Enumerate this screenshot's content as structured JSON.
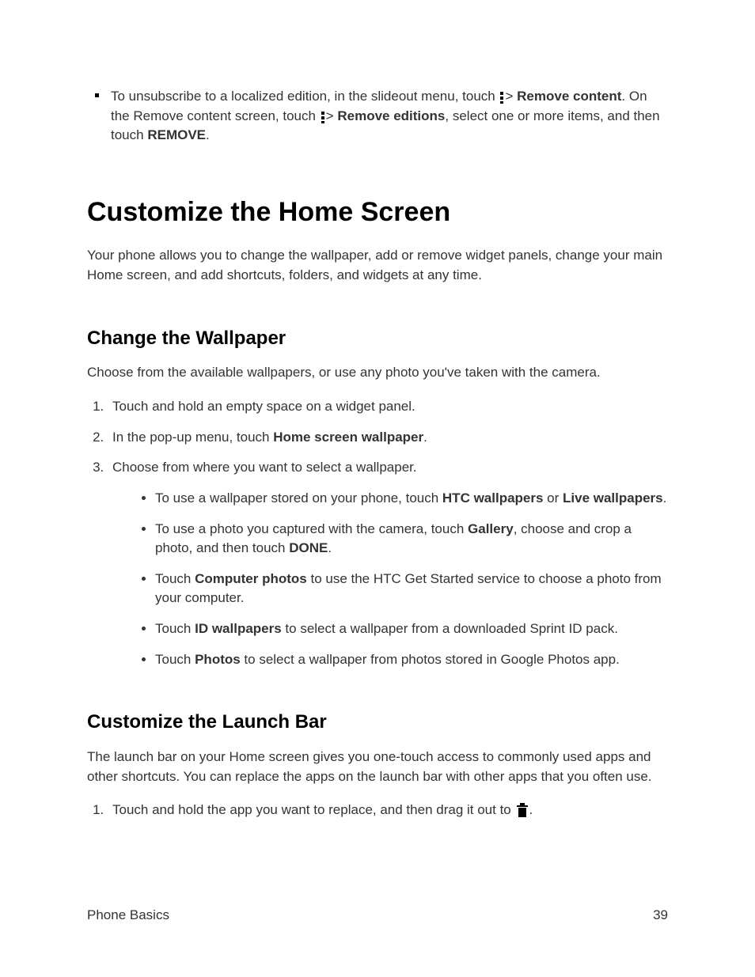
{
  "unsub": {
    "p1": "To unsubscribe to a localized edition, in the slideout menu, touch",
    "p2": ">",
    "b1": "Remove content",
    "p3": ". On the Remove content screen, touch",
    "p4": ">",
    "b2": "Remove editions",
    "p5": ", select one or more items, and then touch",
    "b3": "REMOVE",
    "p6": "."
  },
  "sec1": {
    "title": "Customize the Home Screen",
    "intro": "Your phone allows you to change the wallpaper, add or remove widget panels, change your main Home screen, and add shortcuts, folders, and widgets at any time."
  },
  "sec2": {
    "title": "Change the Wallpaper",
    "intro": "Choose from the available wallpapers, or use any photo you've taken with the camera.",
    "step1": "Touch and hold an empty space on a widget panel.",
    "step2a": "In the pop-up menu, touch ",
    "step2b": "Home screen wallpaper",
    "step2c": ".",
    "step3": "Choose from where you want to select a wallpaper.",
    "b1a": "To use a wallpaper stored on your phone, touch ",
    "b1b": "HTC wallpapers",
    "b1c": " or ",
    "b1d": "Live wallpapers",
    "b1e": ".",
    "b2a": "To use a photo you captured with the camera, touch ",
    "b2b": "Gallery",
    "b2c": ", choose and crop a photo, and then touch ",
    "b2d": "DONE",
    "b2e": ".",
    "b3a": "Touch ",
    "b3b": "Computer photos",
    "b3c": " to use the HTC Get Started service to choose a photo from your computer.",
    "b4a": "Touch ",
    "b4b": "ID wallpapers",
    "b4c": " to select a wallpaper from a downloaded Sprint ID pack.",
    "b5a": "Touch ",
    "b5b": "Photos",
    "b5c": " to select a wallpaper from photos stored in Google Photos app."
  },
  "sec3": {
    "title": "Customize the Launch Bar",
    "intro": "The launch bar on your Home screen gives you one-touch access to commonly used apps and other shortcuts. You can replace the apps on the launch bar with other apps that you often use.",
    "step1a": "Touch and hold the app you want to replace, and then drag it out to ",
    "step1b": "."
  },
  "footer": {
    "left": "Phone Basics",
    "right": "39"
  }
}
